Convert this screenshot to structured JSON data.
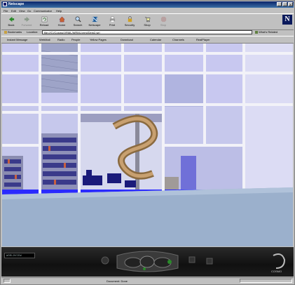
{
  "window": {
    "title": "Netscape"
  },
  "menu": [
    "File",
    "Edit",
    "View",
    "Go",
    "Communicator",
    "Help"
  ],
  "toolbar": {
    "buttons": [
      {
        "label": "Back",
        "icon": "back-arrow-icon",
        "enabled": true
      },
      {
        "label": "Forward",
        "icon": "forward-arrow-icon",
        "enabled": false
      },
      {
        "label": "Reload",
        "icon": "reload-icon",
        "enabled": true
      },
      {
        "label": "Home",
        "icon": "home-icon",
        "enabled": true
      },
      {
        "label": "Search",
        "icon": "search-icon",
        "enabled": true
      },
      {
        "label": "Netscape",
        "icon": "netscape-icon",
        "enabled": true
      },
      {
        "label": "Print",
        "icon": "print-icon",
        "enabled": true
      },
      {
        "label": "Security",
        "icon": "security-icon",
        "enabled": true
      },
      {
        "label": "Shop",
        "icon": "shop-icon",
        "enabled": true
      },
      {
        "label": "Stop",
        "icon": "stop-icon",
        "enabled": false
      }
    ]
  },
  "location": {
    "bookmarks_label": "Bookmarks",
    "location_label": "Location:",
    "url": "file:///C|/Cosmo/VRML/WRML/vrml/Dem2.wrl",
    "related_label": "What's Related"
  },
  "personal_toolbar": [
    "Instant Message",
    "WebMail",
    "Radio",
    "People",
    "Yellow Pages",
    "Download",
    "Calendar",
    "Channels",
    "RealPlayer"
  ],
  "viewer": {
    "display_text": "WORLDVIEW",
    "logo_text": "COSMO"
  },
  "status": {
    "text": "Document: Done"
  },
  "colors": {
    "accent_blue": "#2a2aff",
    "sky": "#8ea0c8",
    "window_pane": "#c8c8f0",
    "floor": "#9bb0cc"
  }
}
